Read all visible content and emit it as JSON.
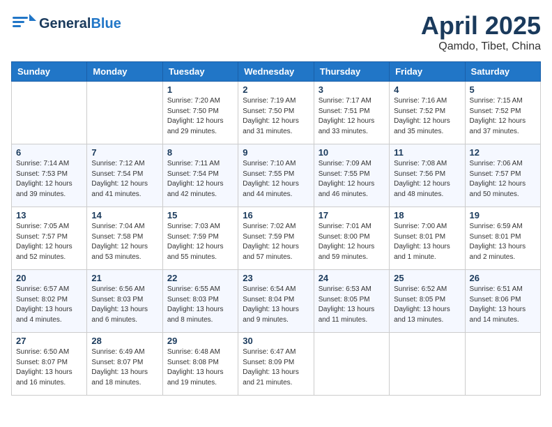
{
  "logo": {
    "general": "General",
    "blue": "Blue"
  },
  "title": {
    "month_year": "April 2025",
    "location": "Qamdo, Tibet, China"
  },
  "headers": [
    "Sunday",
    "Monday",
    "Tuesday",
    "Wednesday",
    "Thursday",
    "Friday",
    "Saturday"
  ],
  "weeks": [
    [
      {
        "day": "",
        "info": ""
      },
      {
        "day": "",
        "info": ""
      },
      {
        "day": "1",
        "info": "Sunrise: 7:20 AM\nSunset: 7:50 PM\nDaylight: 12 hours\nand 29 minutes."
      },
      {
        "day": "2",
        "info": "Sunrise: 7:19 AM\nSunset: 7:50 PM\nDaylight: 12 hours\nand 31 minutes."
      },
      {
        "day": "3",
        "info": "Sunrise: 7:17 AM\nSunset: 7:51 PM\nDaylight: 12 hours\nand 33 minutes."
      },
      {
        "day": "4",
        "info": "Sunrise: 7:16 AM\nSunset: 7:52 PM\nDaylight: 12 hours\nand 35 minutes."
      },
      {
        "day": "5",
        "info": "Sunrise: 7:15 AM\nSunset: 7:52 PM\nDaylight: 12 hours\nand 37 minutes."
      }
    ],
    [
      {
        "day": "6",
        "info": "Sunrise: 7:14 AM\nSunset: 7:53 PM\nDaylight: 12 hours\nand 39 minutes."
      },
      {
        "day": "7",
        "info": "Sunrise: 7:12 AM\nSunset: 7:54 PM\nDaylight: 12 hours\nand 41 minutes."
      },
      {
        "day": "8",
        "info": "Sunrise: 7:11 AM\nSunset: 7:54 PM\nDaylight: 12 hours\nand 42 minutes."
      },
      {
        "day": "9",
        "info": "Sunrise: 7:10 AM\nSunset: 7:55 PM\nDaylight: 12 hours\nand 44 minutes."
      },
      {
        "day": "10",
        "info": "Sunrise: 7:09 AM\nSunset: 7:55 PM\nDaylight: 12 hours\nand 46 minutes."
      },
      {
        "day": "11",
        "info": "Sunrise: 7:08 AM\nSunset: 7:56 PM\nDaylight: 12 hours\nand 48 minutes."
      },
      {
        "day": "12",
        "info": "Sunrise: 7:06 AM\nSunset: 7:57 PM\nDaylight: 12 hours\nand 50 minutes."
      }
    ],
    [
      {
        "day": "13",
        "info": "Sunrise: 7:05 AM\nSunset: 7:57 PM\nDaylight: 12 hours\nand 52 minutes."
      },
      {
        "day": "14",
        "info": "Sunrise: 7:04 AM\nSunset: 7:58 PM\nDaylight: 12 hours\nand 53 minutes."
      },
      {
        "day": "15",
        "info": "Sunrise: 7:03 AM\nSunset: 7:59 PM\nDaylight: 12 hours\nand 55 minutes."
      },
      {
        "day": "16",
        "info": "Sunrise: 7:02 AM\nSunset: 7:59 PM\nDaylight: 12 hours\nand 57 minutes."
      },
      {
        "day": "17",
        "info": "Sunrise: 7:01 AM\nSunset: 8:00 PM\nDaylight: 12 hours\nand 59 minutes."
      },
      {
        "day": "18",
        "info": "Sunrise: 7:00 AM\nSunset: 8:01 PM\nDaylight: 13 hours\nand 1 minute."
      },
      {
        "day": "19",
        "info": "Sunrise: 6:59 AM\nSunset: 8:01 PM\nDaylight: 13 hours\nand 2 minutes."
      }
    ],
    [
      {
        "day": "20",
        "info": "Sunrise: 6:57 AM\nSunset: 8:02 PM\nDaylight: 13 hours\nand 4 minutes."
      },
      {
        "day": "21",
        "info": "Sunrise: 6:56 AM\nSunset: 8:03 PM\nDaylight: 13 hours\nand 6 minutes."
      },
      {
        "day": "22",
        "info": "Sunrise: 6:55 AM\nSunset: 8:03 PM\nDaylight: 13 hours\nand 8 minutes."
      },
      {
        "day": "23",
        "info": "Sunrise: 6:54 AM\nSunset: 8:04 PM\nDaylight: 13 hours\nand 9 minutes."
      },
      {
        "day": "24",
        "info": "Sunrise: 6:53 AM\nSunset: 8:05 PM\nDaylight: 13 hours\nand 11 minutes."
      },
      {
        "day": "25",
        "info": "Sunrise: 6:52 AM\nSunset: 8:05 PM\nDaylight: 13 hours\nand 13 minutes."
      },
      {
        "day": "26",
        "info": "Sunrise: 6:51 AM\nSunset: 8:06 PM\nDaylight: 13 hours\nand 14 minutes."
      }
    ],
    [
      {
        "day": "27",
        "info": "Sunrise: 6:50 AM\nSunset: 8:07 PM\nDaylight: 13 hours\nand 16 minutes."
      },
      {
        "day": "28",
        "info": "Sunrise: 6:49 AM\nSunset: 8:07 PM\nDaylight: 13 hours\nand 18 minutes."
      },
      {
        "day": "29",
        "info": "Sunrise: 6:48 AM\nSunset: 8:08 PM\nDaylight: 13 hours\nand 19 minutes."
      },
      {
        "day": "30",
        "info": "Sunrise: 6:47 AM\nSunset: 8:09 PM\nDaylight: 13 hours\nand 21 minutes."
      },
      {
        "day": "",
        "info": ""
      },
      {
        "day": "",
        "info": ""
      },
      {
        "day": "",
        "info": ""
      }
    ]
  ]
}
